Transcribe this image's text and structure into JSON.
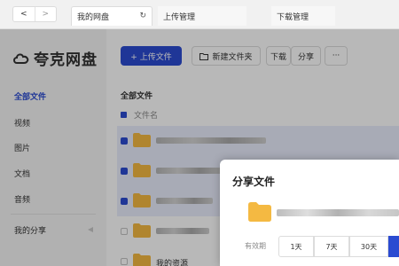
{
  "tabs": {
    "back": "<",
    "forward": ">",
    "items": [
      "我的网盘",
      "上传管理",
      "下载管理"
    ]
  },
  "sidebar": {
    "logo": "夸克网盘",
    "items": [
      "全部文件",
      "视频",
      "图片",
      "文档",
      "音频"
    ],
    "my_share": "我的分享"
  },
  "toolbar": {
    "upload": "+ 上传文件",
    "new_folder": "新建文件夹",
    "download": "下载",
    "share": "分享",
    "more": "···"
  },
  "files": {
    "section_title": "全部文件",
    "column_name": "文件名",
    "last_visible_name": "我的资源"
  },
  "dialog": {
    "title": "分享文件",
    "expiry_label": "有效期",
    "options": [
      "1天",
      "7天",
      "30天"
    ]
  },
  "colors": {
    "accent": "#2b4bd1",
    "folder": "#f4b942"
  }
}
